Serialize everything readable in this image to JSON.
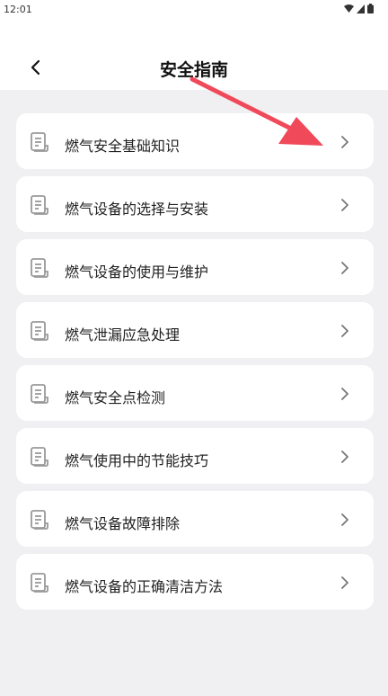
{
  "status_bar": {
    "time": "12:01"
  },
  "header": {
    "title": "安全指南"
  },
  "items": [
    {
      "label": "燃气安全基础知识"
    },
    {
      "label": "燃气设备的选择与安装"
    },
    {
      "label": "燃气设备的使用与维护"
    },
    {
      "label": "燃气泄漏应急处理"
    },
    {
      "label": "燃气安全点检测"
    },
    {
      "label": "燃气使用中的节能技巧"
    },
    {
      "label": "燃气设备故障排除"
    },
    {
      "label": "燃气设备的正确清洁方法"
    }
  ],
  "colors": {
    "annotation": "#f0495a",
    "icon": "#999999",
    "chevron": "#777777"
  }
}
